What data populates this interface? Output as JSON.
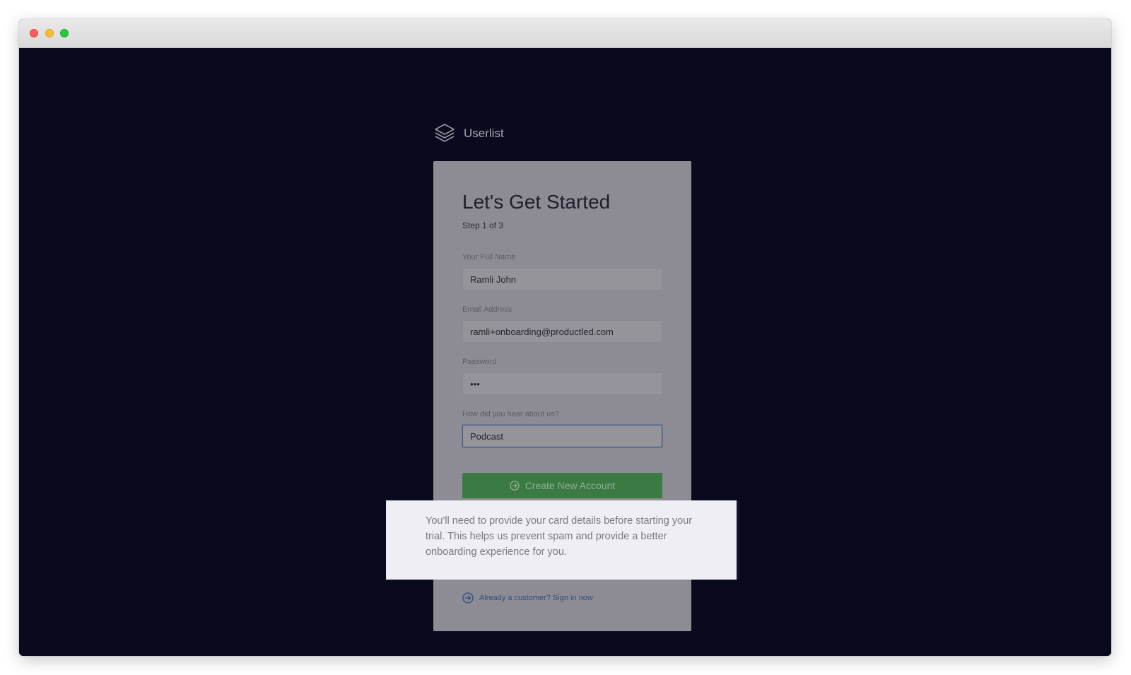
{
  "brand": {
    "name": "Userlist",
    "logo_icon": "stacked-layers-icon"
  },
  "signup_card": {
    "title": "Let's Get Started",
    "step": "Step 1 of 3",
    "fields": {
      "full_name": {
        "label": "Your Full Name",
        "value": "Ramli John"
      },
      "email": {
        "label": "Email Address",
        "value": "ramli+onboarding@productled.com"
      },
      "password": {
        "label": "Password",
        "value": "•••"
      },
      "referral": {
        "label": "How did you hear about us?",
        "value": "Podcast"
      }
    },
    "create_button": {
      "label": "Create New Account",
      "icon": "arrow-circle-right-icon"
    },
    "signin_link": {
      "label": "Already a customer? Sign in now",
      "icon": "arrow-circle-right-icon"
    }
  },
  "tooltip": {
    "text": "You'll need to provide your card details before starting your trial. This helps us prevent spam and provide a better onboarding experience for you."
  },
  "colors": {
    "background": "#0a0a1e",
    "card": "#8d8b93",
    "primary_button": "#3c7a44",
    "link": "#2f4e80",
    "tooltip_bg": "#efeef4"
  }
}
